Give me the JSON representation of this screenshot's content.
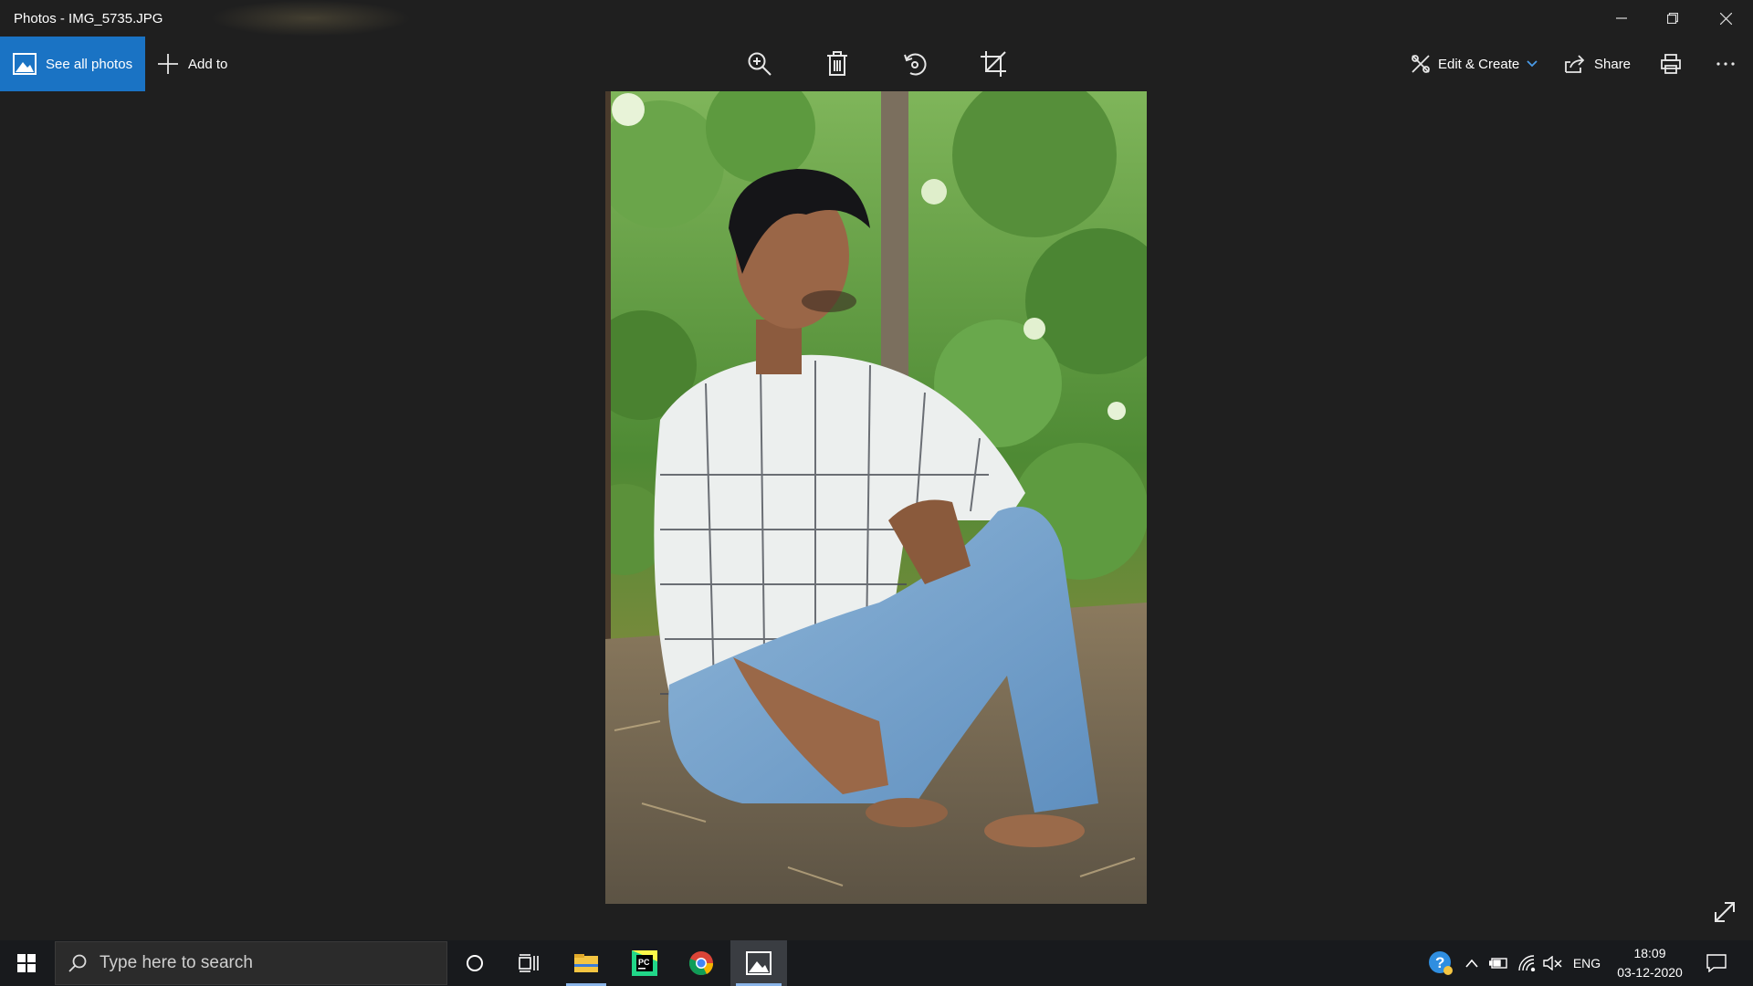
{
  "window": {
    "title": "Photos - IMG_5735.JPG"
  },
  "toolbar": {
    "see_all_label": "See all photos",
    "add_to_label": "Add to",
    "edit_create_label": "Edit & Create",
    "share_label": "Share"
  },
  "icons": {
    "photos_logo": "photos-app-icon",
    "zoom": "zoom-in-icon",
    "delete": "trash-icon",
    "rotate": "rotate-icon",
    "crop": "crop-icon",
    "edit": "edit-create-icon",
    "share": "share-icon",
    "print": "print-icon",
    "more": "more-icon",
    "expand": "fullscreen-icon"
  },
  "colors": {
    "accent": "#1a73c4",
    "background": "#1f1f1f",
    "taskbar": "#181a1d"
  },
  "taskbar": {
    "search_placeholder": "Type here to search",
    "language": "ENG",
    "time": "18:09",
    "date": "03-12-2020"
  }
}
